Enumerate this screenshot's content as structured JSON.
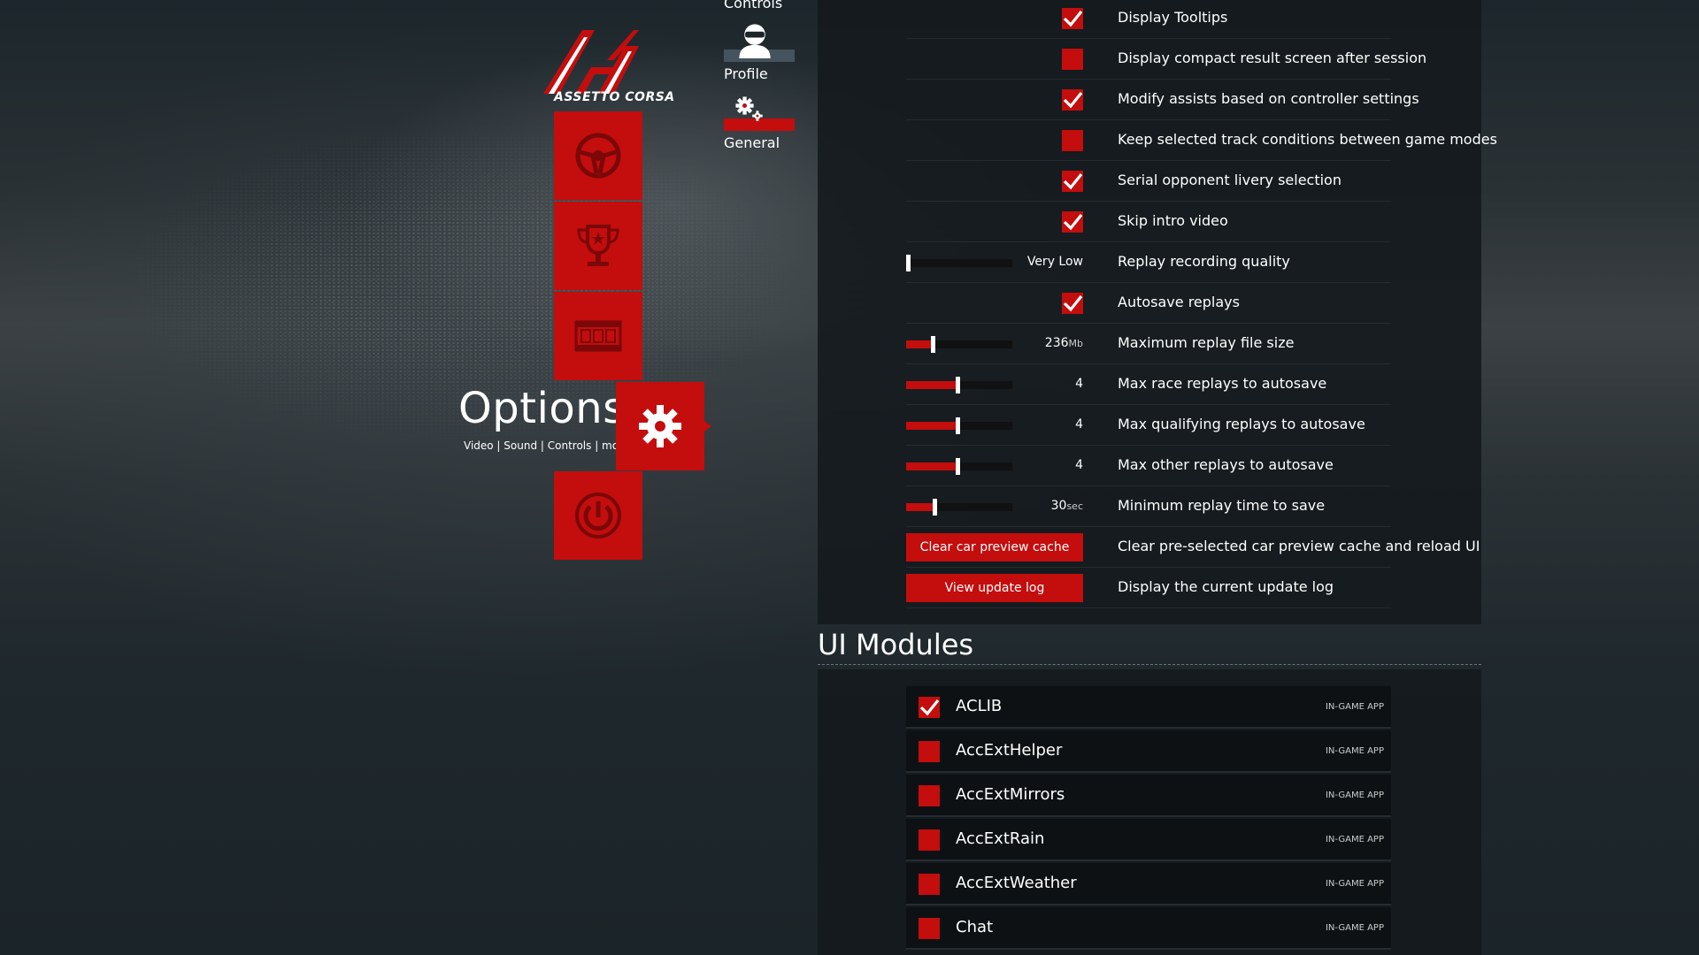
{
  "brand": {
    "name": "ASSETTO CORSA"
  },
  "main_menu": {
    "section_title": "Options",
    "section_subtitle": "Video | Sound | Controls | more",
    "tiles": [
      {
        "name": "drive",
        "icon": "steering-wheel-icon"
      },
      {
        "name": "career",
        "icon": "trophy-icon"
      },
      {
        "name": "replay",
        "icon": "film-strip-icon"
      },
      {
        "name": "options",
        "icon": "gear-icon"
      },
      {
        "name": "quit",
        "icon": "power-icon"
      }
    ]
  },
  "sub_nav": {
    "controls_label": "Controls",
    "items": [
      {
        "label": "Profile",
        "icon": "helmet-driver-icon",
        "active": false
      },
      {
        "label": "General",
        "icon": "gears-icon",
        "active": true
      }
    ]
  },
  "settings": [
    {
      "type": "checkbox",
      "label": "Display Tooltips",
      "checked": true
    },
    {
      "type": "checkbox",
      "label": "Display compact result screen after session",
      "checked": false
    },
    {
      "type": "checkbox",
      "label": "Modify assists based on controller settings",
      "checked": true
    },
    {
      "type": "checkbox",
      "label": "Keep selected track conditions between game modes",
      "checked": false
    },
    {
      "type": "checkbox",
      "label": "Serial opponent livery selection",
      "checked": true
    },
    {
      "type": "checkbox",
      "label": "Skip intro video",
      "checked": true
    },
    {
      "type": "slider",
      "label": "Replay recording quality",
      "value": "Very Low",
      "unit": "",
      "level": 0.0
    },
    {
      "type": "checkbox",
      "label": "Autosave replays",
      "checked": true
    },
    {
      "type": "slider",
      "label": "Maximum replay file size",
      "value": "236",
      "unit": "Mb",
      "level": 0.25
    },
    {
      "type": "slider",
      "label": "Max race replays to autosave",
      "value": "4",
      "unit": "",
      "level": 0.48
    },
    {
      "type": "slider",
      "label": "Max qualifying replays to autosave",
      "value": "4",
      "unit": "",
      "level": 0.48
    },
    {
      "type": "slider",
      "label": "Max other replays to autosave",
      "value": "4",
      "unit": "",
      "level": 0.48
    },
    {
      "type": "slider",
      "label": "Minimum replay time to save",
      "value": "30",
      "unit": "sec",
      "level": 0.27
    },
    {
      "type": "button",
      "button_label": "Clear car preview cache",
      "label": "Clear pre-selected car preview cache and reload UI"
    },
    {
      "type": "button",
      "button_label": "View update log",
      "label": "Display the current update log"
    }
  ],
  "ui_modules": {
    "title": "UI Modules",
    "items": [
      {
        "name": "ACLIB",
        "type": "IN-GAME APP",
        "enabled": true
      },
      {
        "name": "AccExtHelper",
        "type": "IN-GAME APP",
        "enabled": false
      },
      {
        "name": "AccExtMirrors",
        "type": "IN-GAME APP",
        "enabled": false
      },
      {
        "name": "AccExtRain",
        "type": "IN-GAME APP",
        "enabled": false
      },
      {
        "name": "AccExtWeather",
        "type": "IN-GAME APP",
        "enabled": false
      },
      {
        "name": "Chat",
        "type": "IN-GAME APP",
        "enabled": false
      }
    ]
  },
  "colors": {
    "accent": "#c40d0d",
    "panel": "#141a1d",
    "background": "#1f282d"
  }
}
